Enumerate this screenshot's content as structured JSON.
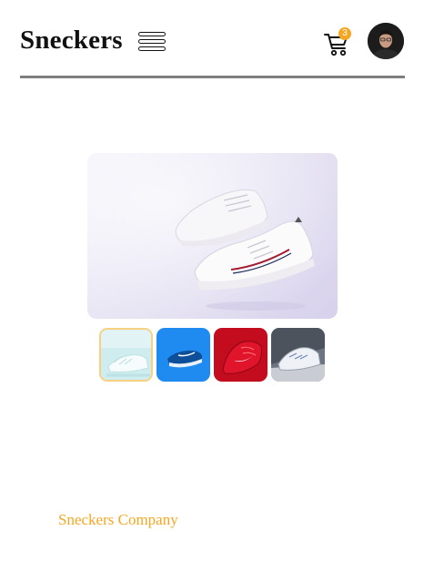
{
  "header": {
    "logo": "Sneckers",
    "menu_icon": "hamburger-menu-icon",
    "cart_icon": "cart-icon",
    "cart_count": "3",
    "avatar_icon": "user-avatar"
  },
  "product": {
    "main_image": "white-sneakers-floating",
    "thumbnails": [
      {
        "name": "white-sneakers-thumb",
        "active": true
      },
      {
        "name": "blue-sneaker-thumb",
        "active": false
      },
      {
        "name": "red-sneaker-thumb",
        "active": false
      },
      {
        "name": "grey-sneaker-thumb",
        "active": false
      }
    ]
  },
  "footer": {
    "brand": "Sneckers Company"
  },
  "colors": {
    "accent": "#f5a623",
    "divider": "#7f7f7f",
    "text": "#111111"
  }
}
